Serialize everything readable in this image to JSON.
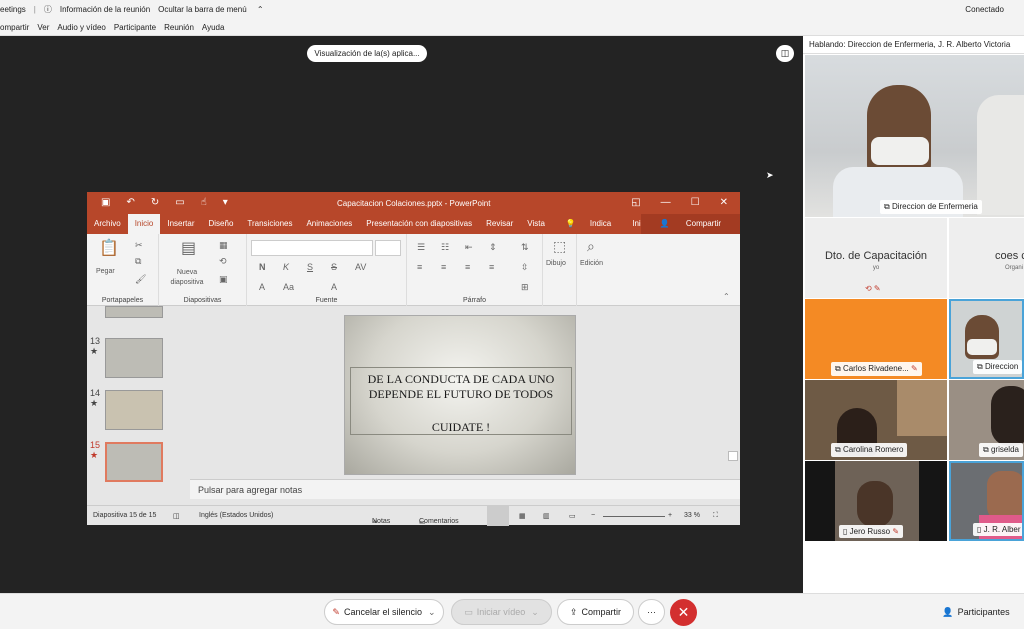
{
  "topbar": {
    "items": [
      "eetings",
      "Información de la reunión",
      "Ocultar la barra de menú"
    ],
    "status": "Conectado"
  },
  "menubar": {
    "items": [
      "ompartir",
      "Ver",
      "Audio y vídeo",
      "Participante",
      "Reunión",
      "Ayuda"
    ]
  },
  "share": {
    "view_pill": "Visualización de la(s) aplica..."
  },
  "ppt": {
    "title": "Capacitacion Colaciones.pptx - PowerPoint",
    "tabs": [
      "Archivo",
      "Inicio",
      "Insertar",
      "Diseño",
      "Transiciones",
      "Animaciones",
      "Presentación con diapositivas",
      "Revisar",
      "Vista"
    ],
    "active_tab": "Inicio",
    "tell_me": "Indica",
    "signin": "Iniciar sesión",
    "share": "Compartir",
    "ribbon": {
      "paste": "Pegar",
      "new_slide": "Nueva diapositiva",
      "draw": "Dibujo",
      "edit": "Edición",
      "groups": [
        "Portapapeles",
        "Diapositivas",
        "Fuente",
        "Párrafo"
      ]
    },
    "thumbs": [
      {
        "num": "13",
        "star": "★"
      },
      {
        "num": "14",
        "star": "★"
      },
      {
        "num": "15",
        "star": "★"
      }
    ],
    "slide": {
      "line1": "DE LA CONDUCTA DE CADA UNO",
      "line2": "DEPENDE EL FUTURO DE TODOS",
      "line3": "CUIDATE !"
    },
    "notes_placeholder": "Pulsar para agregar notas",
    "status": {
      "slide": "Diapositiva 15 de 15",
      "lang": "Inglés (Estados Unidos)",
      "notes": "Notas",
      "comments": "Comentarios",
      "zoom": "33 %"
    }
  },
  "side": {
    "speaking": "Hablando: Direccion de Enfermeria, J. R. Alberto Victoria",
    "tiles": [
      {
        "name": "Direccion de Enfermeria"
      },
      {
        "name": "Dto. de Capacitación",
        "sub": "yo"
      },
      {
        "name": "coes c",
        "sub": "Organi"
      },
      {
        "name": "Carlos Rivadene..."
      },
      {
        "name": "Direccion"
      },
      {
        "name": "Carolina Romero"
      },
      {
        "name": "griselda"
      },
      {
        "name": "Jero Russo"
      },
      {
        "name": "J. R. Alber"
      }
    ]
  },
  "bottom": {
    "mute": "Cancelar el silencio",
    "video": "Iniciar vídeo",
    "share": "Compartir",
    "more": "···",
    "participants": "Participantes"
  }
}
